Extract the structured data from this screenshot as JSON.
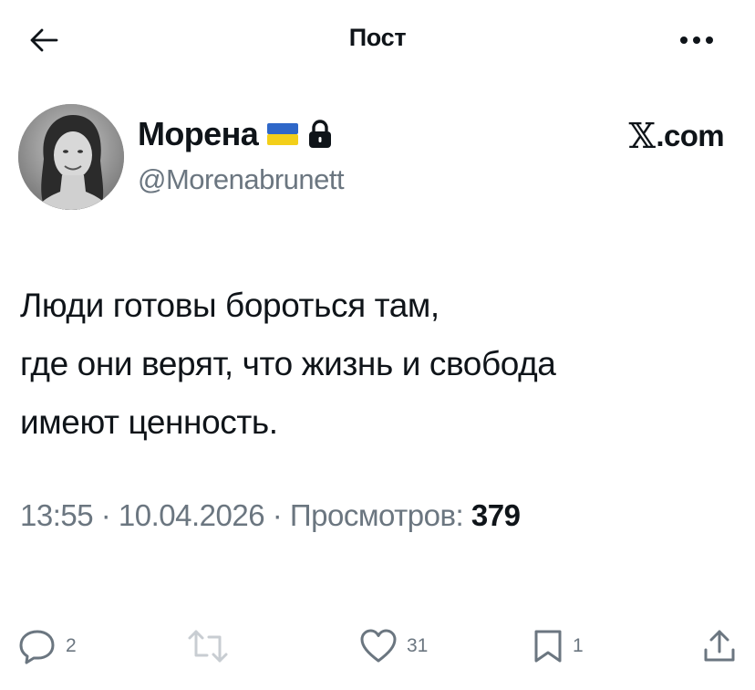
{
  "header": {
    "title": "Пост"
  },
  "author": {
    "display_name": "Морена",
    "handle": "@Morenabrunett",
    "flag_icon": "ukraine-flag-icon",
    "lock_icon": "lock-icon"
  },
  "source": {
    "x_glyph": "𝕏",
    "suffix": ".com"
  },
  "post": {
    "lines": [
      "Люди готовы бороться там,",
      "где они верят, что жизнь и свобода",
      "имеют ценность."
    ]
  },
  "meta": {
    "time": "13:55",
    "separator": " · ",
    "date": "10.04.2026",
    "views_label": "Просмотров:",
    "views_count": "379"
  },
  "actions": {
    "replies": "2",
    "reposts": "",
    "likes": "31",
    "bookmarks": "1"
  },
  "colors": {
    "text": "#0f1419",
    "secondary": "#6b7680",
    "background": "#ffffff",
    "flag_blue": "#2f67c8",
    "flag_yellow": "#f3cf1a"
  }
}
